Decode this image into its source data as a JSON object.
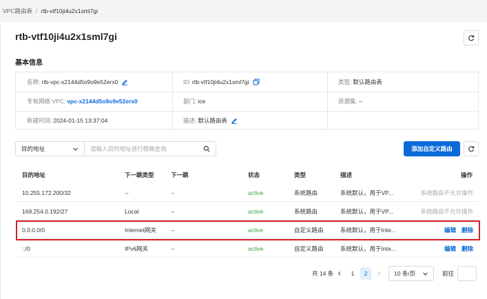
{
  "breadcrumb": {
    "parent": "VPC路由表",
    "separator": "/",
    "current": "rtb-vtf10ji4u2x1sml7gi"
  },
  "title": "rtb-vtf10ji4u2x1sml7gi",
  "basic_info": {
    "section_title": "基本信息",
    "name_label": "名称:",
    "name_value": "rtb-vpc-x2144d5o9o9e52erx0",
    "id_label": "ID:",
    "id_value": "rtb-vtf10ji4u2x1sml7gi",
    "type_label": "类型:",
    "type_value": "默认路由表",
    "vpc_label": "专有网络 VPC:",
    "vpc_value": "vpc-x2144d5o9o9e52erx0",
    "dept_label": "部门:",
    "dept_value": "ice",
    "resource_label": "资源集:",
    "resource_value": "--",
    "created_label": "新建时间:",
    "created_value": "2024-01-15 13:37:04",
    "desc_label": "描述:",
    "desc_value": "默认路由表"
  },
  "filter": {
    "select_value": "目的地址",
    "placeholder": "请输入目的地址进行精确查询"
  },
  "add_button": "添加自定义路由",
  "table": {
    "headers": {
      "dest": "目的地址",
      "hop_type": "下一跳类型",
      "hop": "下一跳",
      "status": "状态",
      "type": "类型",
      "desc": "描述",
      "ops": "操作"
    },
    "rows": [
      {
        "dest": "10.255.172.200/32",
        "hop_type": "--",
        "hop": "--",
        "status": "active",
        "type": "系统路由",
        "desc": "系统默认，用于VP...",
        "op_text": "系统路由不允许操作"
      },
      {
        "dest": "169.254.0.192/27",
        "hop_type": "Local",
        "hop": "--",
        "status": "active",
        "type": "系统路由",
        "desc": "系统默认，用于VP...",
        "op_text": "系统路由不允许操作"
      },
      {
        "dest": "0.0.0.0/0",
        "hop_type": "Internet网关",
        "hop": "--",
        "status": "active",
        "type": "自定义路由",
        "desc": "系统默认，用于Inte...",
        "edit": "编辑",
        "delete": "删除"
      },
      {
        "dest": "::/0",
        "hop_type": "IPv6网关",
        "hop": "--",
        "status": "active",
        "type": "自定义路由",
        "desc": "系统默认，用于Inte...",
        "edit": "编辑",
        "delete": "删除"
      }
    ]
  },
  "pagination": {
    "total": "共 14 条",
    "pages": [
      "1",
      "2"
    ],
    "current_page": "2",
    "page_size": "10 条/页",
    "goto_label": "前往"
  },
  "colors": {
    "primary": "#0a6ad8",
    "active": "#2aa44f",
    "highlight": "#d0202a"
  }
}
